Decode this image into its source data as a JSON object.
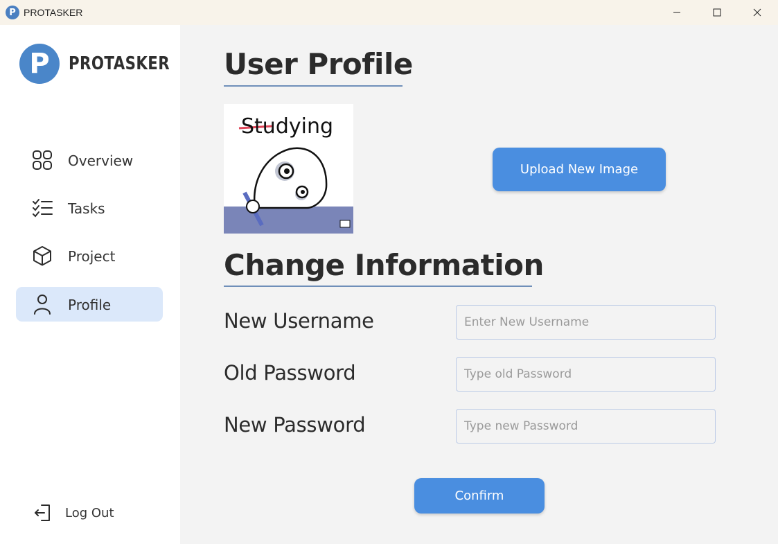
{
  "window": {
    "title": "PROTASKER",
    "app_icon_letter": "P",
    "controls": [
      "minimize-icon",
      "maximize-icon",
      "close-icon"
    ]
  },
  "sidebar": {
    "brand_name": "PROTASKER",
    "brand_logo_letter": "P",
    "items": [
      {
        "label": "Overview",
        "icon": "grid-icon",
        "active": false
      },
      {
        "label": "Tasks",
        "icon": "checklist-icon",
        "active": false
      },
      {
        "label": "Project",
        "icon": "cube-icon",
        "active": false
      },
      {
        "label": "Profile",
        "icon": "user-icon",
        "active": true
      }
    ],
    "logout_label": "Log Out"
  },
  "main": {
    "profile_heading": "User Profile",
    "avatar_caption": "Studying",
    "upload_button": "Upload New Image",
    "change_heading": "Change Information",
    "fields": [
      {
        "label": "New Username",
        "placeholder": "Enter New Username",
        "value": ""
      },
      {
        "label": "Old Password",
        "placeholder": "Type old Password",
        "value": ""
      },
      {
        "label": "New Password",
        "placeholder": "Type new Password",
        "value": ""
      }
    ],
    "confirm_button": "Confirm"
  },
  "colors": {
    "accent": "#4a8ee0",
    "active_nav_bg": "#dbe8fa",
    "titlebar_bg": "#f8f3ea",
    "main_bg": "#f3f3f3",
    "logo_blue": "#4a86c9"
  }
}
